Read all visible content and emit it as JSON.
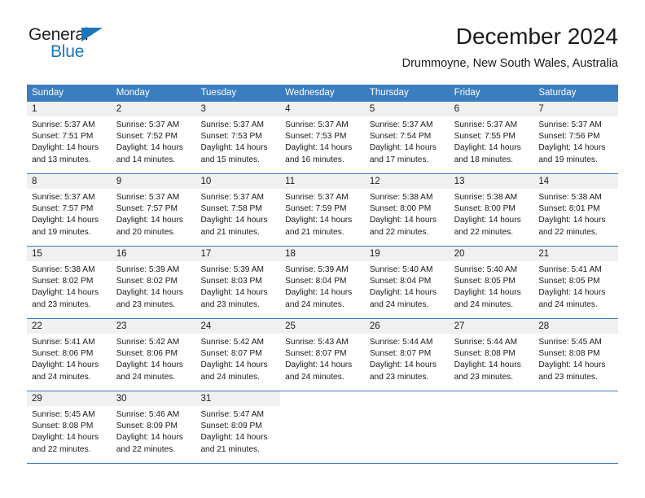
{
  "brand": {
    "name_top": "General",
    "name_bottom": "Blue",
    "accent_color": "#1b75bb"
  },
  "header": {
    "title": "December 2024",
    "subtitle": "Drummoyne, New South Wales, Australia"
  },
  "calendar": {
    "header_color": "#3a7ebf",
    "daynum_strip_color": "#f0f0f0",
    "weekdays": [
      "Sunday",
      "Monday",
      "Tuesday",
      "Wednesday",
      "Thursday",
      "Friday",
      "Saturday"
    ],
    "weeks": [
      [
        {
          "day": "1",
          "sunrise": "Sunrise: 5:37 AM",
          "sunset": "Sunset: 7:51 PM",
          "daylight_1": "Daylight: 14 hours",
          "daylight_2": "and 13 minutes."
        },
        {
          "day": "2",
          "sunrise": "Sunrise: 5:37 AM",
          "sunset": "Sunset: 7:52 PM",
          "daylight_1": "Daylight: 14 hours",
          "daylight_2": "and 14 minutes."
        },
        {
          "day": "3",
          "sunrise": "Sunrise: 5:37 AM",
          "sunset": "Sunset: 7:53 PM",
          "daylight_1": "Daylight: 14 hours",
          "daylight_2": "and 15 minutes."
        },
        {
          "day": "4",
          "sunrise": "Sunrise: 5:37 AM",
          "sunset": "Sunset: 7:53 PM",
          "daylight_1": "Daylight: 14 hours",
          "daylight_2": "and 16 minutes."
        },
        {
          "day": "5",
          "sunrise": "Sunrise: 5:37 AM",
          "sunset": "Sunset: 7:54 PM",
          "daylight_1": "Daylight: 14 hours",
          "daylight_2": "and 17 minutes."
        },
        {
          "day": "6",
          "sunrise": "Sunrise: 5:37 AM",
          "sunset": "Sunset: 7:55 PM",
          "daylight_1": "Daylight: 14 hours",
          "daylight_2": "and 18 minutes."
        },
        {
          "day": "7",
          "sunrise": "Sunrise: 5:37 AM",
          "sunset": "Sunset: 7:56 PM",
          "daylight_1": "Daylight: 14 hours",
          "daylight_2": "and 19 minutes."
        }
      ],
      [
        {
          "day": "8",
          "sunrise": "Sunrise: 5:37 AM",
          "sunset": "Sunset: 7:57 PM",
          "daylight_1": "Daylight: 14 hours",
          "daylight_2": "and 19 minutes."
        },
        {
          "day": "9",
          "sunrise": "Sunrise: 5:37 AM",
          "sunset": "Sunset: 7:57 PM",
          "daylight_1": "Daylight: 14 hours",
          "daylight_2": "and 20 minutes."
        },
        {
          "day": "10",
          "sunrise": "Sunrise: 5:37 AM",
          "sunset": "Sunset: 7:58 PM",
          "daylight_1": "Daylight: 14 hours",
          "daylight_2": "and 21 minutes."
        },
        {
          "day": "11",
          "sunrise": "Sunrise: 5:37 AM",
          "sunset": "Sunset: 7:59 PM",
          "daylight_1": "Daylight: 14 hours",
          "daylight_2": "and 21 minutes."
        },
        {
          "day": "12",
          "sunrise": "Sunrise: 5:38 AM",
          "sunset": "Sunset: 8:00 PM",
          "daylight_1": "Daylight: 14 hours",
          "daylight_2": "and 22 minutes."
        },
        {
          "day": "13",
          "sunrise": "Sunrise: 5:38 AM",
          "sunset": "Sunset: 8:00 PM",
          "daylight_1": "Daylight: 14 hours",
          "daylight_2": "and 22 minutes."
        },
        {
          "day": "14",
          "sunrise": "Sunrise: 5:38 AM",
          "sunset": "Sunset: 8:01 PM",
          "daylight_1": "Daylight: 14 hours",
          "daylight_2": "and 22 minutes."
        }
      ],
      [
        {
          "day": "15",
          "sunrise": "Sunrise: 5:38 AM",
          "sunset": "Sunset: 8:02 PM",
          "daylight_1": "Daylight: 14 hours",
          "daylight_2": "and 23 minutes."
        },
        {
          "day": "16",
          "sunrise": "Sunrise: 5:39 AM",
          "sunset": "Sunset: 8:02 PM",
          "daylight_1": "Daylight: 14 hours",
          "daylight_2": "and 23 minutes."
        },
        {
          "day": "17",
          "sunrise": "Sunrise: 5:39 AM",
          "sunset": "Sunset: 8:03 PM",
          "daylight_1": "Daylight: 14 hours",
          "daylight_2": "and 23 minutes."
        },
        {
          "day": "18",
          "sunrise": "Sunrise: 5:39 AM",
          "sunset": "Sunset: 8:04 PM",
          "daylight_1": "Daylight: 14 hours",
          "daylight_2": "and 24 minutes."
        },
        {
          "day": "19",
          "sunrise": "Sunrise: 5:40 AM",
          "sunset": "Sunset: 8:04 PM",
          "daylight_1": "Daylight: 14 hours",
          "daylight_2": "and 24 minutes."
        },
        {
          "day": "20",
          "sunrise": "Sunrise: 5:40 AM",
          "sunset": "Sunset: 8:05 PM",
          "daylight_1": "Daylight: 14 hours",
          "daylight_2": "and 24 minutes."
        },
        {
          "day": "21",
          "sunrise": "Sunrise: 5:41 AM",
          "sunset": "Sunset: 8:05 PM",
          "daylight_1": "Daylight: 14 hours",
          "daylight_2": "and 24 minutes."
        }
      ],
      [
        {
          "day": "22",
          "sunrise": "Sunrise: 5:41 AM",
          "sunset": "Sunset: 8:06 PM",
          "daylight_1": "Daylight: 14 hours",
          "daylight_2": "and 24 minutes."
        },
        {
          "day": "23",
          "sunrise": "Sunrise: 5:42 AM",
          "sunset": "Sunset: 8:06 PM",
          "daylight_1": "Daylight: 14 hours",
          "daylight_2": "and 24 minutes."
        },
        {
          "day": "24",
          "sunrise": "Sunrise: 5:42 AM",
          "sunset": "Sunset: 8:07 PM",
          "daylight_1": "Daylight: 14 hours",
          "daylight_2": "and 24 minutes."
        },
        {
          "day": "25",
          "sunrise": "Sunrise: 5:43 AM",
          "sunset": "Sunset: 8:07 PM",
          "daylight_1": "Daylight: 14 hours",
          "daylight_2": "and 24 minutes."
        },
        {
          "day": "26",
          "sunrise": "Sunrise: 5:44 AM",
          "sunset": "Sunset: 8:07 PM",
          "daylight_1": "Daylight: 14 hours",
          "daylight_2": "and 23 minutes."
        },
        {
          "day": "27",
          "sunrise": "Sunrise: 5:44 AM",
          "sunset": "Sunset: 8:08 PM",
          "daylight_1": "Daylight: 14 hours",
          "daylight_2": "and 23 minutes."
        },
        {
          "day": "28",
          "sunrise": "Sunrise: 5:45 AM",
          "sunset": "Sunset: 8:08 PM",
          "daylight_1": "Daylight: 14 hours",
          "daylight_2": "and 23 minutes."
        }
      ],
      [
        {
          "day": "29",
          "sunrise": "Sunrise: 5:45 AM",
          "sunset": "Sunset: 8:08 PM",
          "daylight_1": "Daylight: 14 hours",
          "daylight_2": "and 22 minutes."
        },
        {
          "day": "30",
          "sunrise": "Sunrise: 5:46 AM",
          "sunset": "Sunset: 8:09 PM",
          "daylight_1": "Daylight: 14 hours",
          "daylight_2": "and 22 minutes."
        },
        {
          "day": "31",
          "sunrise": "Sunrise: 5:47 AM",
          "sunset": "Sunset: 8:09 PM",
          "daylight_1": "Daylight: 14 hours",
          "daylight_2": "and 21 minutes."
        },
        {
          "day": "",
          "sunrise": "",
          "sunset": "",
          "daylight_1": "",
          "daylight_2": ""
        },
        {
          "day": "",
          "sunrise": "",
          "sunset": "",
          "daylight_1": "",
          "daylight_2": ""
        },
        {
          "day": "",
          "sunrise": "",
          "sunset": "",
          "daylight_1": "",
          "daylight_2": ""
        },
        {
          "day": "",
          "sunrise": "",
          "sunset": "",
          "daylight_1": "",
          "daylight_2": ""
        }
      ]
    ]
  }
}
